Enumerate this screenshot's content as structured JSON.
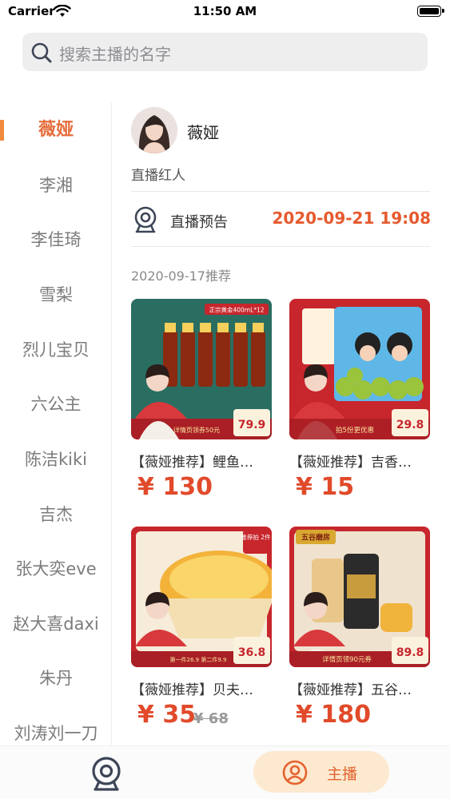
{
  "status_bar": {
    "carrier": "Carrier",
    "time": "11:50 AM"
  },
  "search": {
    "placeholder": "搜索主播的名字"
  },
  "sidebar": {
    "items": [
      {
        "label": "薇娅",
        "active": true
      },
      {
        "label": "李湘"
      },
      {
        "label": "李佳琦"
      },
      {
        "label": "雪梨"
      },
      {
        "label": "烈儿宝贝"
      },
      {
        "label": "六公主"
      },
      {
        "label": "陈洁kiki"
      },
      {
        "label": "吉杰"
      },
      {
        "label": "张大奕eve"
      },
      {
        "label": "赵大喜daxi"
      },
      {
        "label": "朱丹"
      },
      {
        "label": "刘涛刘一刀"
      }
    ]
  },
  "anchor": {
    "name": "薇娅",
    "tag": "直播红人",
    "live_label": "直播预告",
    "live_time": "2020-09-21 19:08",
    "recommend_date": "2020-09-17推荐"
  },
  "products": [
    {
      "title": "【薇娅推荐】鲤鱼…",
      "price": "¥ 130",
      "original_price": "",
      "image": {
        "top_text": "正宗黄金400mL*12",
        "badge_price": "79.9",
        "bottom_text": "详情页领券50元",
        "theme": "#2a6e62"
      }
    },
    {
      "title": "【薇娅推荐】吉香…",
      "price": "¥ 15",
      "original_price": "",
      "image": {
        "top_text": "",
        "badge_price": "29.8",
        "bottom_text": "拍5份更优惠",
        "theme": "#c7262c"
      }
    },
    {
      "title": "【薇娅推荐】贝夫…",
      "price": "¥ 35",
      "original_price": "¥ 68",
      "image": {
        "top_text": "推荐拍 2件",
        "badge_price": "36.8",
        "bottom_text": "第一件26.9 第二件9.9",
        "theme": "#c7262c"
      }
    },
    {
      "title": "【薇娅推荐】五谷…",
      "price": "¥ 180",
      "original_price": "",
      "image": {
        "top_text": "五谷磨房",
        "badge_price": "89.8",
        "bottom_text": "详情页领90元券",
        "theme": "#c7262c"
      }
    }
  ],
  "tabbar": {
    "anchor_label": "主播"
  },
  "colors": {
    "accent": "#e65a2e",
    "active_side": "#e56d3b",
    "tab_pill": "#fde9cf"
  }
}
